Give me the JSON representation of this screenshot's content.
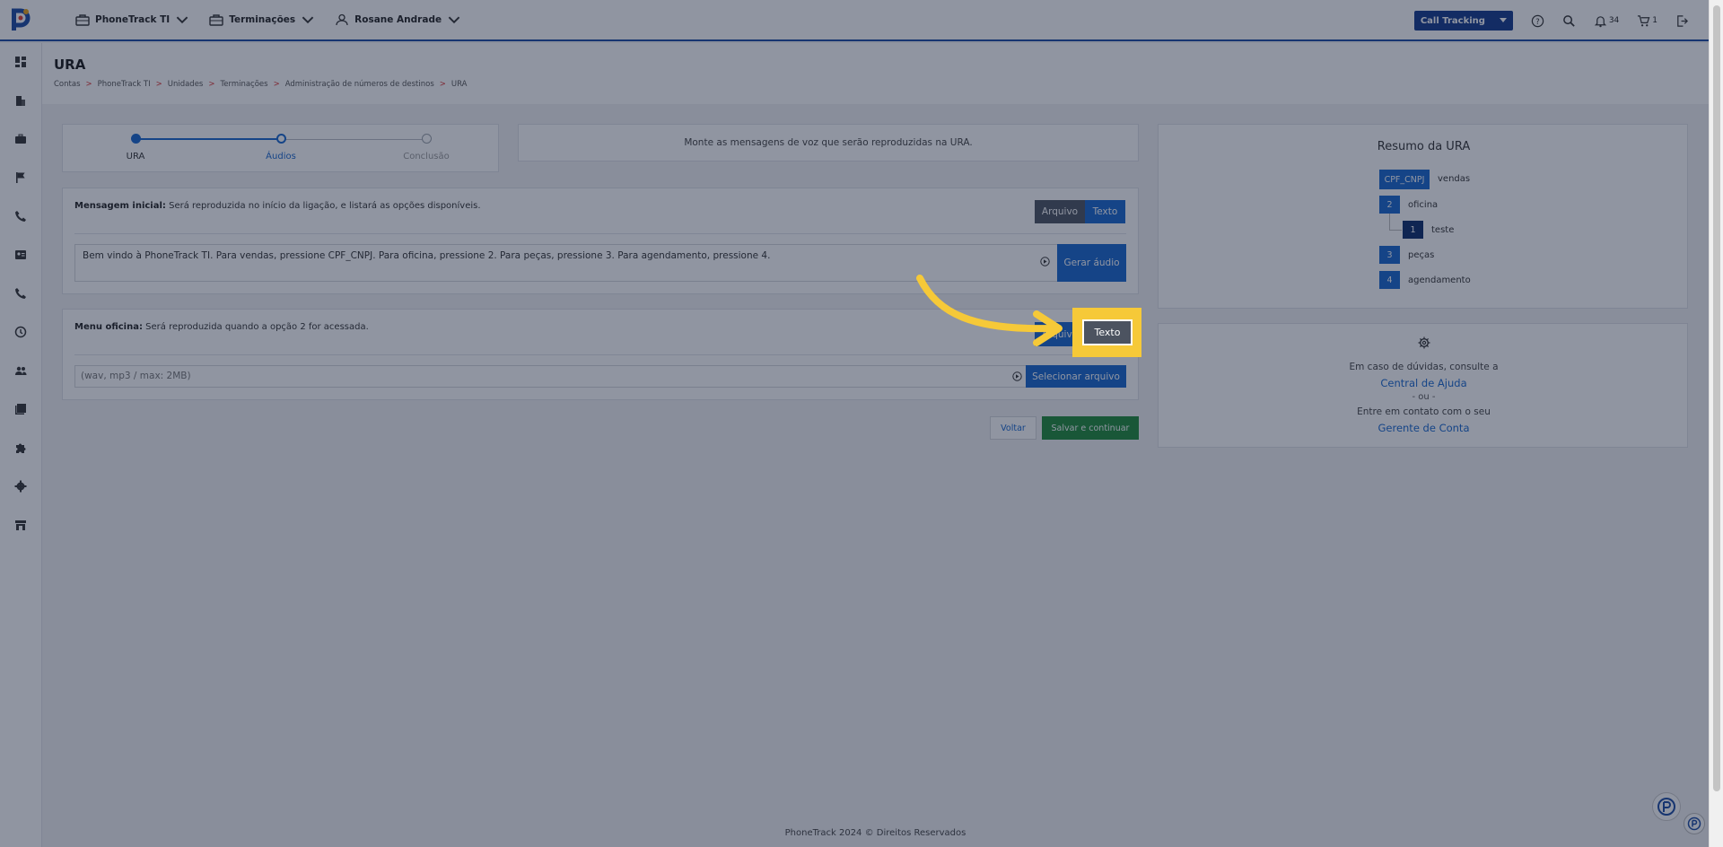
{
  "topbar": {
    "nav": [
      "PhoneTrack TI",
      "Terminações",
      "Rosane Andrade"
    ],
    "product_select": "Call Tracking",
    "notifications_count": "34",
    "cart_count": "1"
  },
  "page": {
    "title": "URA",
    "breadcrumb": [
      "Contas",
      "PhoneTrack TI",
      "Unidades",
      "Terminações",
      "Administração de números de destinos",
      "URA"
    ]
  },
  "stepper": {
    "steps": [
      "URA",
      "Áudios",
      "Conclusão"
    ],
    "current_index": 1
  },
  "info_message": "Monte as mensagens de voz que serão reproduzidas na URA.",
  "initial_message": {
    "label": "Mensagem inicial:",
    "description": "Será reproduzida no início da ligação, e listará as opções disponíveis.",
    "toggle_file": "Arquivo",
    "toggle_text": "Texto",
    "text_value": "Bem vindo à PhoneTrack TI. Para vendas, pressione CPF_CNPJ. Para oficina, pressione 2. Para peças, pressione 3. Para agendamento, pressione 4.",
    "generate_button": "Gerar áudio"
  },
  "menu_oficina": {
    "label": "Menu oficina:",
    "description": "Será reproduzida quando a opção 2 for acessada.",
    "toggle_file": "Arquivo",
    "toggle_text": "Texto",
    "file_placeholder": "(wav, mp3 / max: 2MB)",
    "select_button": "Selecionar arquivo"
  },
  "actions": {
    "back": "Voltar",
    "save": "Salvar e continuar"
  },
  "summary": {
    "title": "Resumo da URA",
    "items": [
      {
        "key": "CPF_CNPJ",
        "label": "vendas"
      },
      {
        "key": "2",
        "label": "oficina"
      },
      {
        "key": "1",
        "label": "teste"
      },
      {
        "key": "3",
        "label": "peças"
      },
      {
        "key": "4",
        "label": "agendamento"
      }
    ]
  },
  "help": {
    "line1": "Em caso de dúvidas, consulte a",
    "link1": "Central de Ajuda",
    "or": "- ou -",
    "line2": "Entre em contato com o seu",
    "link2": "Gerente de Conta"
  },
  "footer": "PhoneTrack 2024 © Direitos Reservados",
  "colors": {
    "accent": "#1767cf",
    "highlight": "#f6c938",
    "save": "#1f8a3a",
    "brand": "#133a8c"
  }
}
